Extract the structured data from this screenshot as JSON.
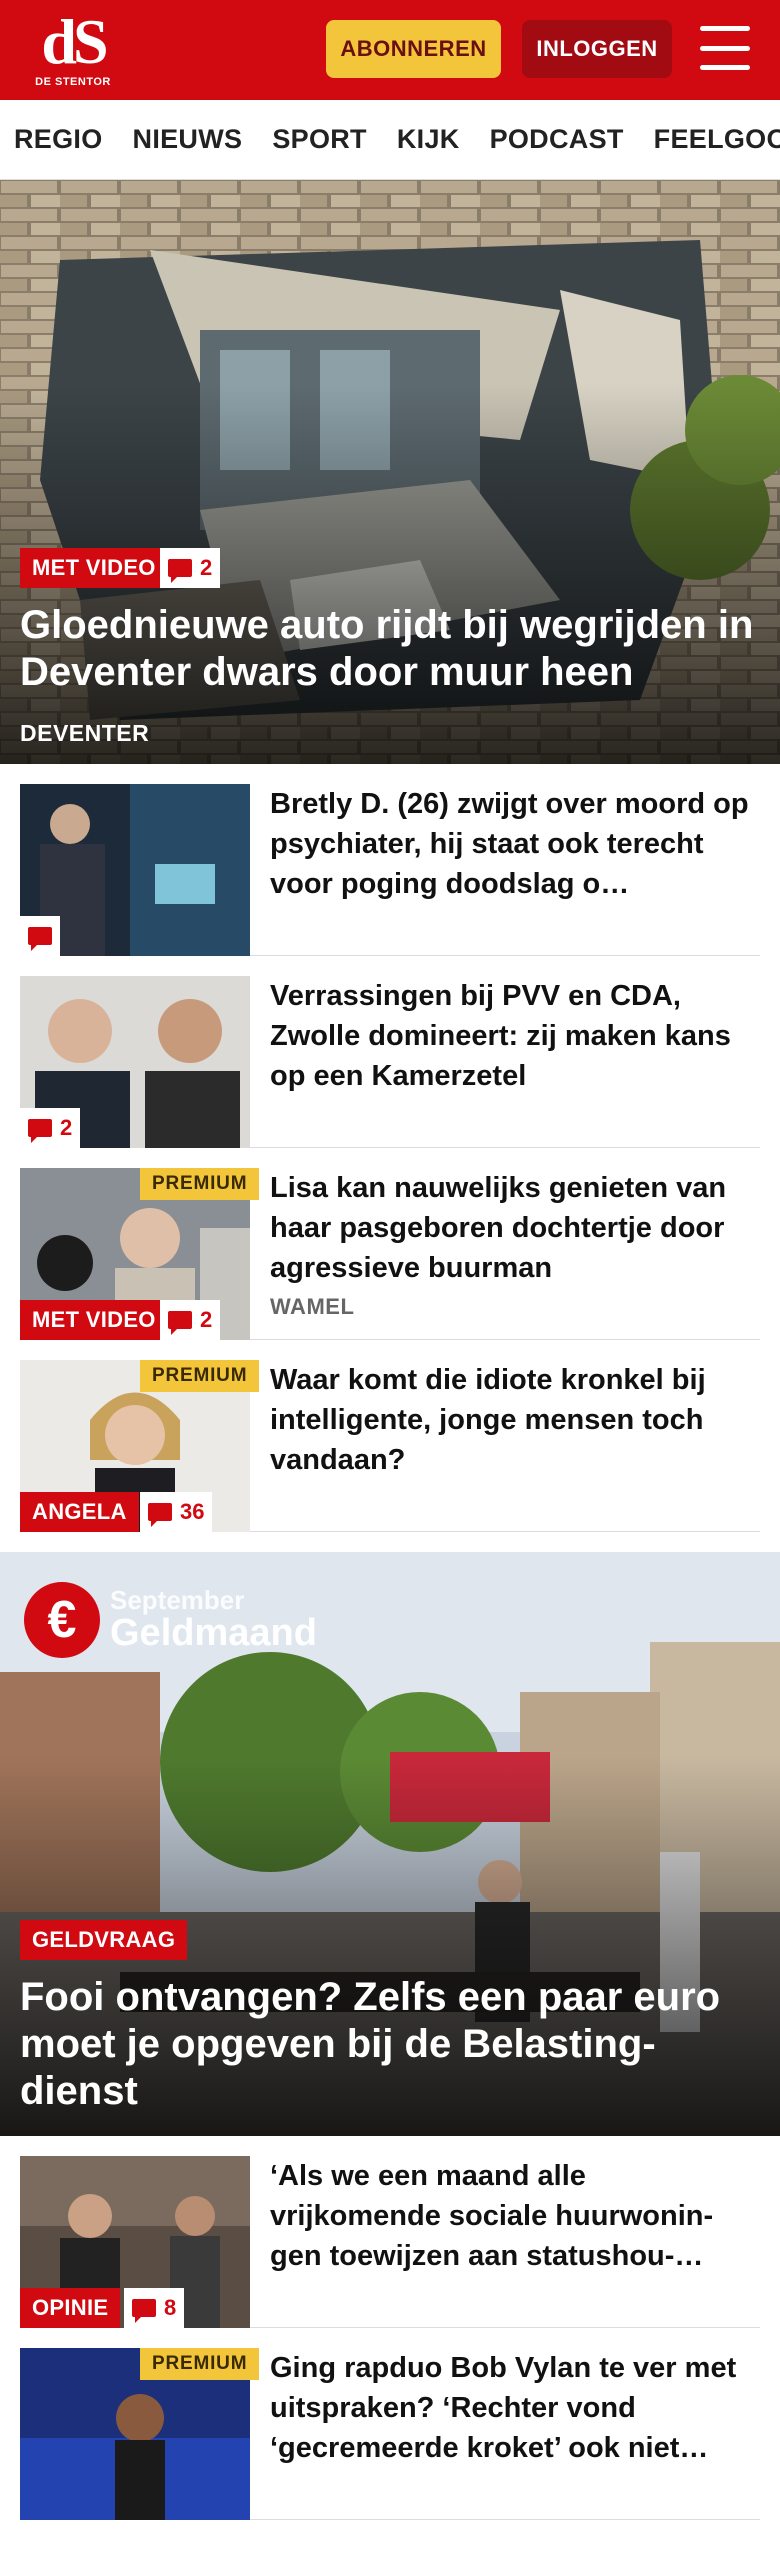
{
  "header": {
    "logo_mark": "dS",
    "logo_sub": "DE STENTOR",
    "subscribe_label": "ABONNEREN",
    "login_label": "INLOGGEN"
  },
  "nav": {
    "items": [
      "REGIO",
      "NIEUWS",
      "SPORT",
      "KIJK",
      "PODCAST",
      "FEELGOOD"
    ]
  },
  "hero1": {
    "tag": "MET VIDEO",
    "comments": "2",
    "title": "Gloednieuwe auto rijdt bij wegrijden in Deventer dwars door muur heen",
    "location": "DEVENTER"
  },
  "articles": [
    {
      "title": "Bretly D. (26) zwijgt over moord op psychiater, hij staat ook terecht voor poging doodslag o…",
      "comments": ""
    },
    {
      "title": "Verrassingen bij PVV en CDA, Zwolle domineert: zij maken kans op een Kamerzetel",
      "comments": "2"
    },
    {
      "title": "Lisa kan nauwelijks genieten van haar pasgeboren dochtertje door agressieve buurman",
      "premium": "PREMIUM",
      "tag": "MET VIDEO",
      "comments": "2",
      "location": "WAMEL"
    },
    {
      "title": "Waar komt die idiote kronkel bij intelligente, jonge mensen toch vandaan?",
      "premium": "PREMIUM",
      "tag": "ANGELA",
      "comments": "36"
    }
  ],
  "hero2": {
    "overlay_small": "September",
    "overlay_big": "Geldmaand",
    "euro": "€",
    "tag": "GELDVRAAG",
    "title": "Fooi ontvangen? Zelfs een paar euro moet je opgeven bij de Belasting-dienst"
  },
  "articles2": [
    {
      "title": "‘Als we een maand alle vrijkomende sociale huurwonin-gen toewijzen aan statushou-…",
      "tag": "OPINIE",
      "comments": "8"
    },
    {
      "title": "Ging rapduo Bob Vylan te ver met uitspraken? ‘Rechter vond ‘gecremeerde kroket’ ook niet…",
      "premium": "PREMIUM"
    }
  ],
  "colors": {
    "brand_red": "#d10a11",
    "subscribe_yellow": "#f3c53a",
    "login_darkred": "#a30b12"
  }
}
